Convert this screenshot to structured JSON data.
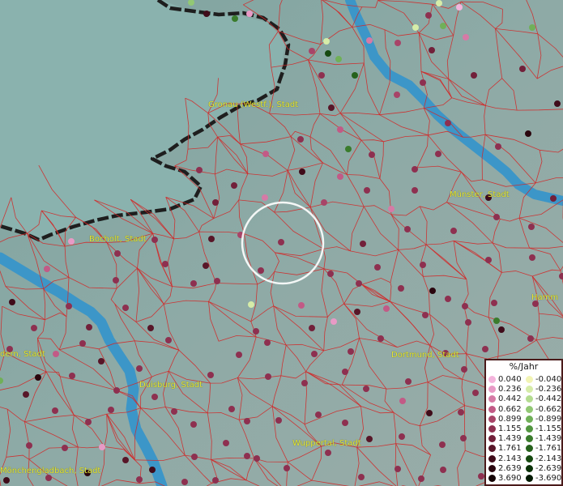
{
  "map": {
    "cities": [
      {
        "key": "gronau",
        "name": "Gronau (Westf.), Stadt"
      },
      {
        "key": "bocholt",
        "name": "Bocholt, Stadt"
      },
      {
        "key": "muenster",
        "name": "Münster, Stadt"
      },
      {
        "key": "hamm",
        "name": "Hamm"
      },
      {
        "key": "dortmund",
        "name": "Dortmund, Stadt"
      },
      {
        "key": "duisburg",
        "name": "Duisburg, Stadt"
      },
      {
        "key": "wuppertal",
        "name": "Wuppertal, Stadt"
      },
      {
        "key": "moenchengladbach",
        "name": "Mönchengladbach, Stadt"
      },
      {
        "key": "krefeld",
        "name": "dern, Stadt"
      }
    ]
  },
  "legend": {
    "title": "%/Jahr",
    "positive": [
      {
        "value": "0.040",
        "color": "#f4b4dc"
      },
      {
        "value": "0.236",
        "color": "#e89ac6"
      },
      {
        "value": "0.442",
        "color": "#d67aa6"
      },
      {
        "value": "0.662",
        "color": "#c25a86"
      },
      {
        "value": "0.899",
        "color": "#a84468"
      },
      {
        "value": "1.155",
        "color": "#8e3050"
      },
      {
        "value": "1.439",
        "color": "#72203a"
      },
      {
        "value": "1.761",
        "color": "#581628"
      },
      {
        "value": "2.143",
        "color": "#400c1a"
      },
      {
        "value": "2.639",
        "color": "#2a060e"
      },
      {
        "value": "3.690",
        "color": "#140204"
      }
    ],
    "negative": [
      {
        "value": "-0.040",
        "color": "#f2f4b4"
      },
      {
        "value": "-0.236",
        "color": "#d6eca8"
      },
      {
        "value": "-0.442",
        "color": "#b4dc90"
      },
      {
        "value": "-0.662",
        "color": "#92c874"
      },
      {
        "value": "-0.899",
        "color": "#70b058"
      },
      {
        "value": "-1.155",
        "color": "#529640"
      },
      {
        "value": "-1.439",
        "color": "#3a7c2c"
      },
      {
        "value": "-1.761",
        "color": "#26621c"
      },
      {
        "value": "-2.143",
        "color": "#164a10"
      },
      {
        "value": "-2.639",
        "color": "#0a3208"
      },
      {
        "value": "-3.690",
        "color": "#021a02"
      }
    ]
  },
  "colors": {
    "river": "#3c96c8",
    "border": "#1e1e1e",
    "district_lines": "#d22828",
    "label": "#e6e635"
  }
}
